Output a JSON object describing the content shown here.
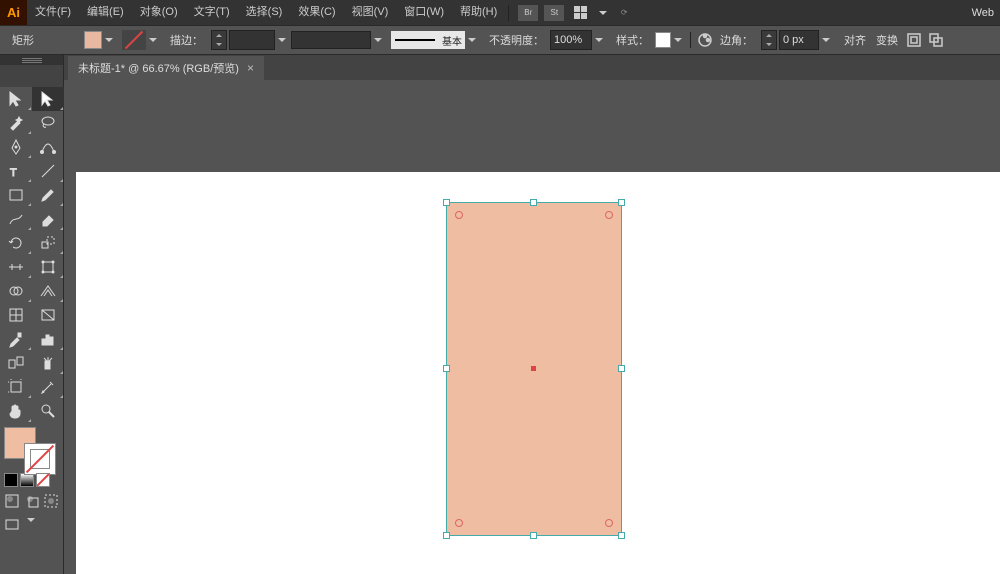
{
  "app": {
    "name": "Ai",
    "web": "Web"
  },
  "menu": {
    "file": "文件(F)",
    "edit": "编辑(E)",
    "object": "对象(O)",
    "type": "文字(T)",
    "select": "选择(S)",
    "effect": "效果(C)",
    "view": "视图(V)",
    "window": "窗口(W)",
    "help": "帮助(H)"
  },
  "optbar": {
    "shape": "矩形",
    "stroke_label": "描边：",
    "stroke_weight": "",
    "dash_label": "基本",
    "opacity_label": "不透明度：",
    "opacity_value": "100%",
    "style_label": "样式：",
    "corner_label": "边角：",
    "corner_value": "0 px",
    "align": "对齐",
    "transform": "变换"
  },
  "tab": {
    "title": "未标题-1* @ 66.67% (RGB/预览)",
    "close": "×"
  },
  "colors": {
    "fill": "#eebda2",
    "artboard": "#ffffff",
    "canvas": "#535353"
  }
}
